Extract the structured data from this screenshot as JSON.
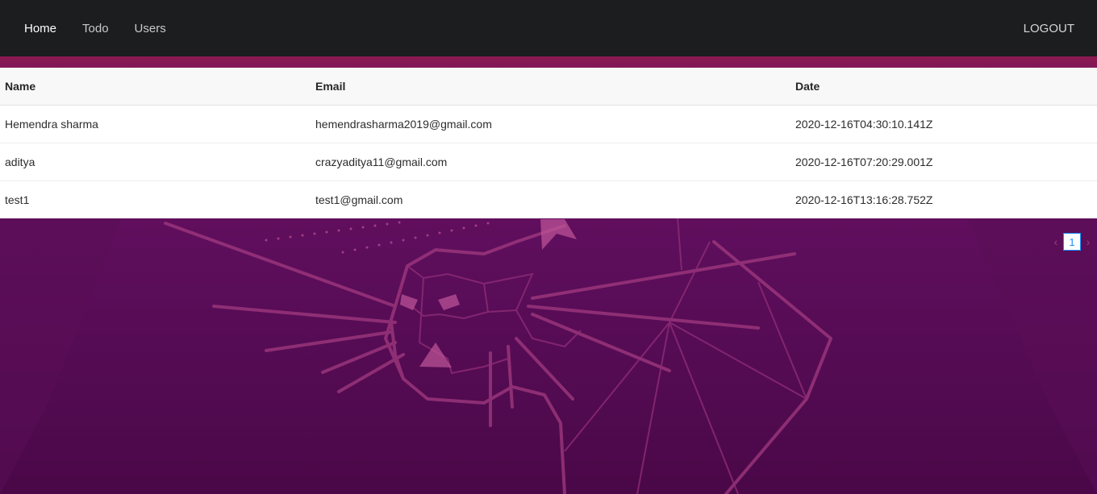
{
  "nav": {
    "links": [
      {
        "label": "Home",
        "active": true
      },
      {
        "label": "Todo",
        "active": false
      },
      {
        "label": "Users",
        "active": false
      }
    ],
    "logout_label": "LOGOUT"
  },
  "table": {
    "headers": {
      "name": "Name",
      "email": "Email",
      "date": "Date"
    },
    "rows": [
      {
        "name": "Hemendra sharma",
        "email": "hemendrasharma2019@gmail.com",
        "date": "2020-12-16T04:30:10.141Z"
      },
      {
        "name": "aditya",
        "email": "crazyaditya11@gmail.com",
        "date": "2020-12-16T07:20:29.001Z"
      },
      {
        "name": "test1",
        "email": "test1@gmail.com",
        "date": "2020-12-16T13:16:28.752Z"
      }
    ]
  },
  "pagination": {
    "current_page": "1",
    "prev_icon": "chevron-left-icon",
    "next_icon": "chevron-right-icon"
  },
  "colors": {
    "navbar": "#1b1d1f",
    "background_top": "#a8203f",
    "background_bottom": "#4a0848",
    "page_active": "#1890ff"
  }
}
